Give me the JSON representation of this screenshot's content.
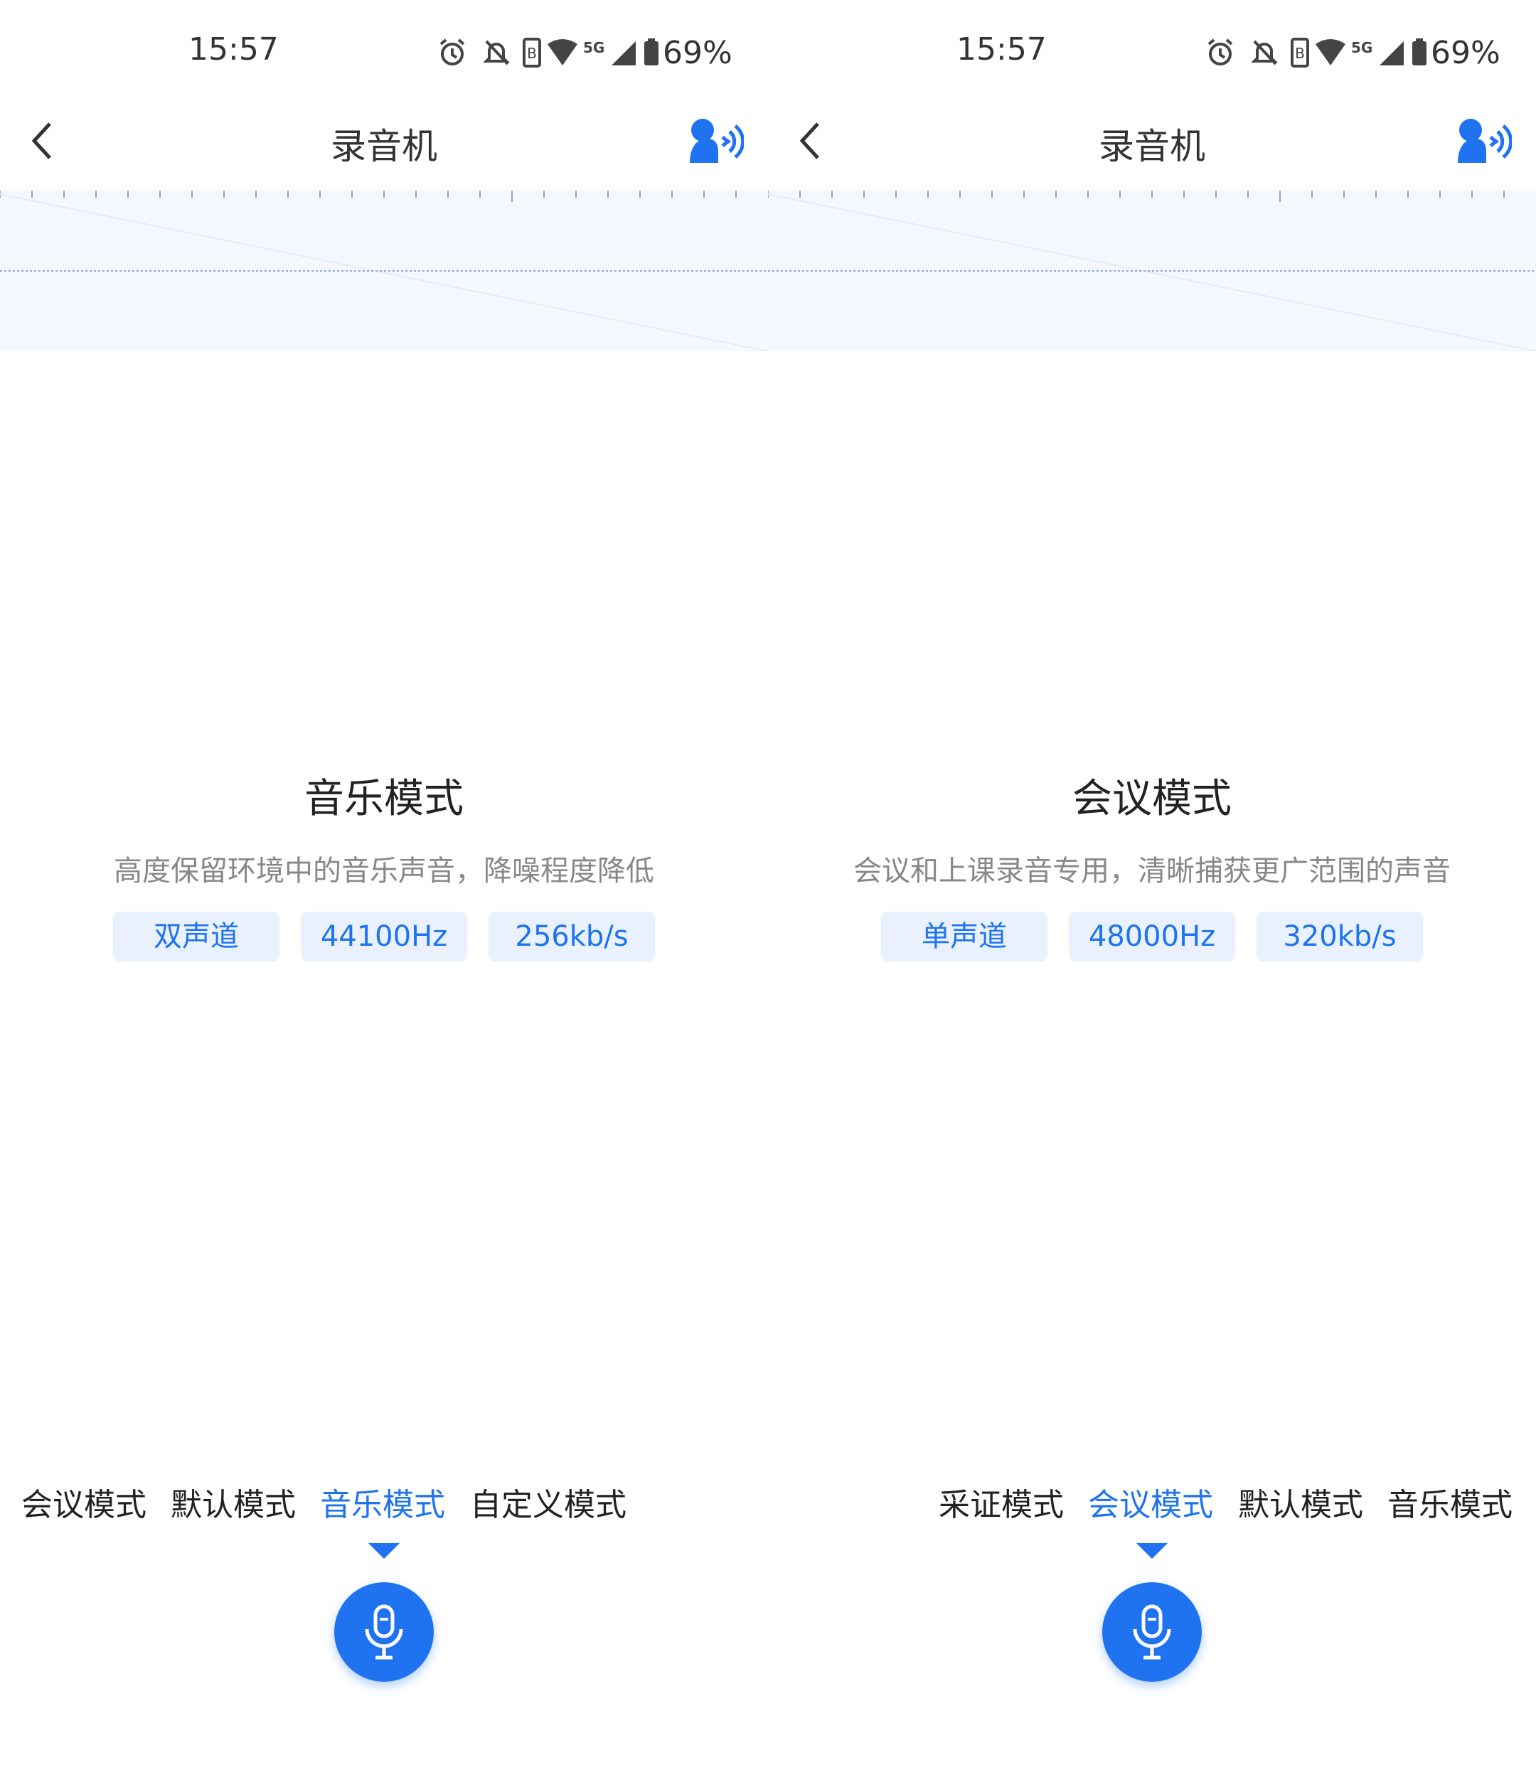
{
  "colors": {
    "accent": "#1f73f0",
    "tag_bg": "#e9f1fe",
    "wave_bg": "#f5f8ff"
  },
  "left": {
    "status": {
      "time": "15:57",
      "battery": "69%",
      "network": "5G"
    },
    "header": {
      "title": "录音机"
    },
    "mode": {
      "title": "音乐模式",
      "description": "高度保留环境中的音乐声音，降噪程度降低",
      "tags": [
        "双声道",
        "44100Hz",
        "256kb/s"
      ]
    },
    "tabs": [
      {
        "label": "会议模式",
        "active": false
      },
      {
        "label": "默认模式",
        "active": false
      },
      {
        "label": "音乐模式",
        "active": true
      },
      {
        "label": "自定义模式",
        "active": false
      }
    ]
  },
  "right": {
    "status": {
      "time": "15:57",
      "battery": "69%",
      "network": "5G"
    },
    "header": {
      "title": "录音机"
    },
    "mode": {
      "title": "会议模式",
      "description": "会议和上课录音专用，清晰捕获更广范围的声音",
      "tags": [
        "单声道",
        "48000Hz",
        "320kb/s"
      ]
    },
    "tabs": [
      {
        "label": "采证模式",
        "active": false
      },
      {
        "label": "会议模式",
        "active": true
      },
      {
        "label": "默认模式",
        "active": false
      },
      {
        "label": "音乐模式",
        "active": false
      }
    ]
  }
}
